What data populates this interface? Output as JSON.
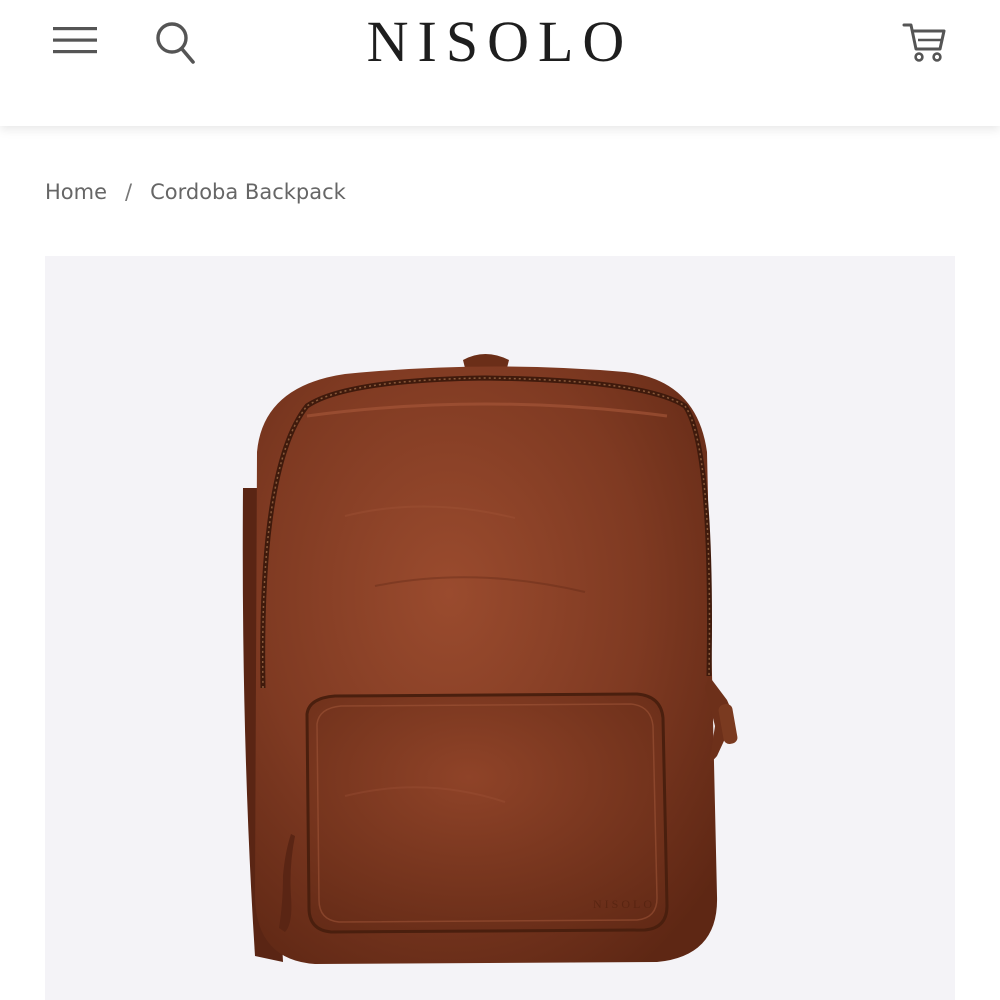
{
  "header": {
    "brand": "NISOLO",
    "menu_icon": "hamburger-menu-icon",
    "search_icon": "search-icon",
    "cart_icon": "shopping-cart-icon"
  },
  "breadcrumb": {
    "home": "Home",
    "separator": "/",
    "current": "Cordoba Backpack"
  },
  "product": {
    "image_subject": "brown-leather-backpack",
    "bag_emboss": "NISOLO",
    "colors": {
      "leather": "#7e3a23",
      "leather_dark": "#5a2514",
      "background": "#f4f3f7"
    }
  }
}
